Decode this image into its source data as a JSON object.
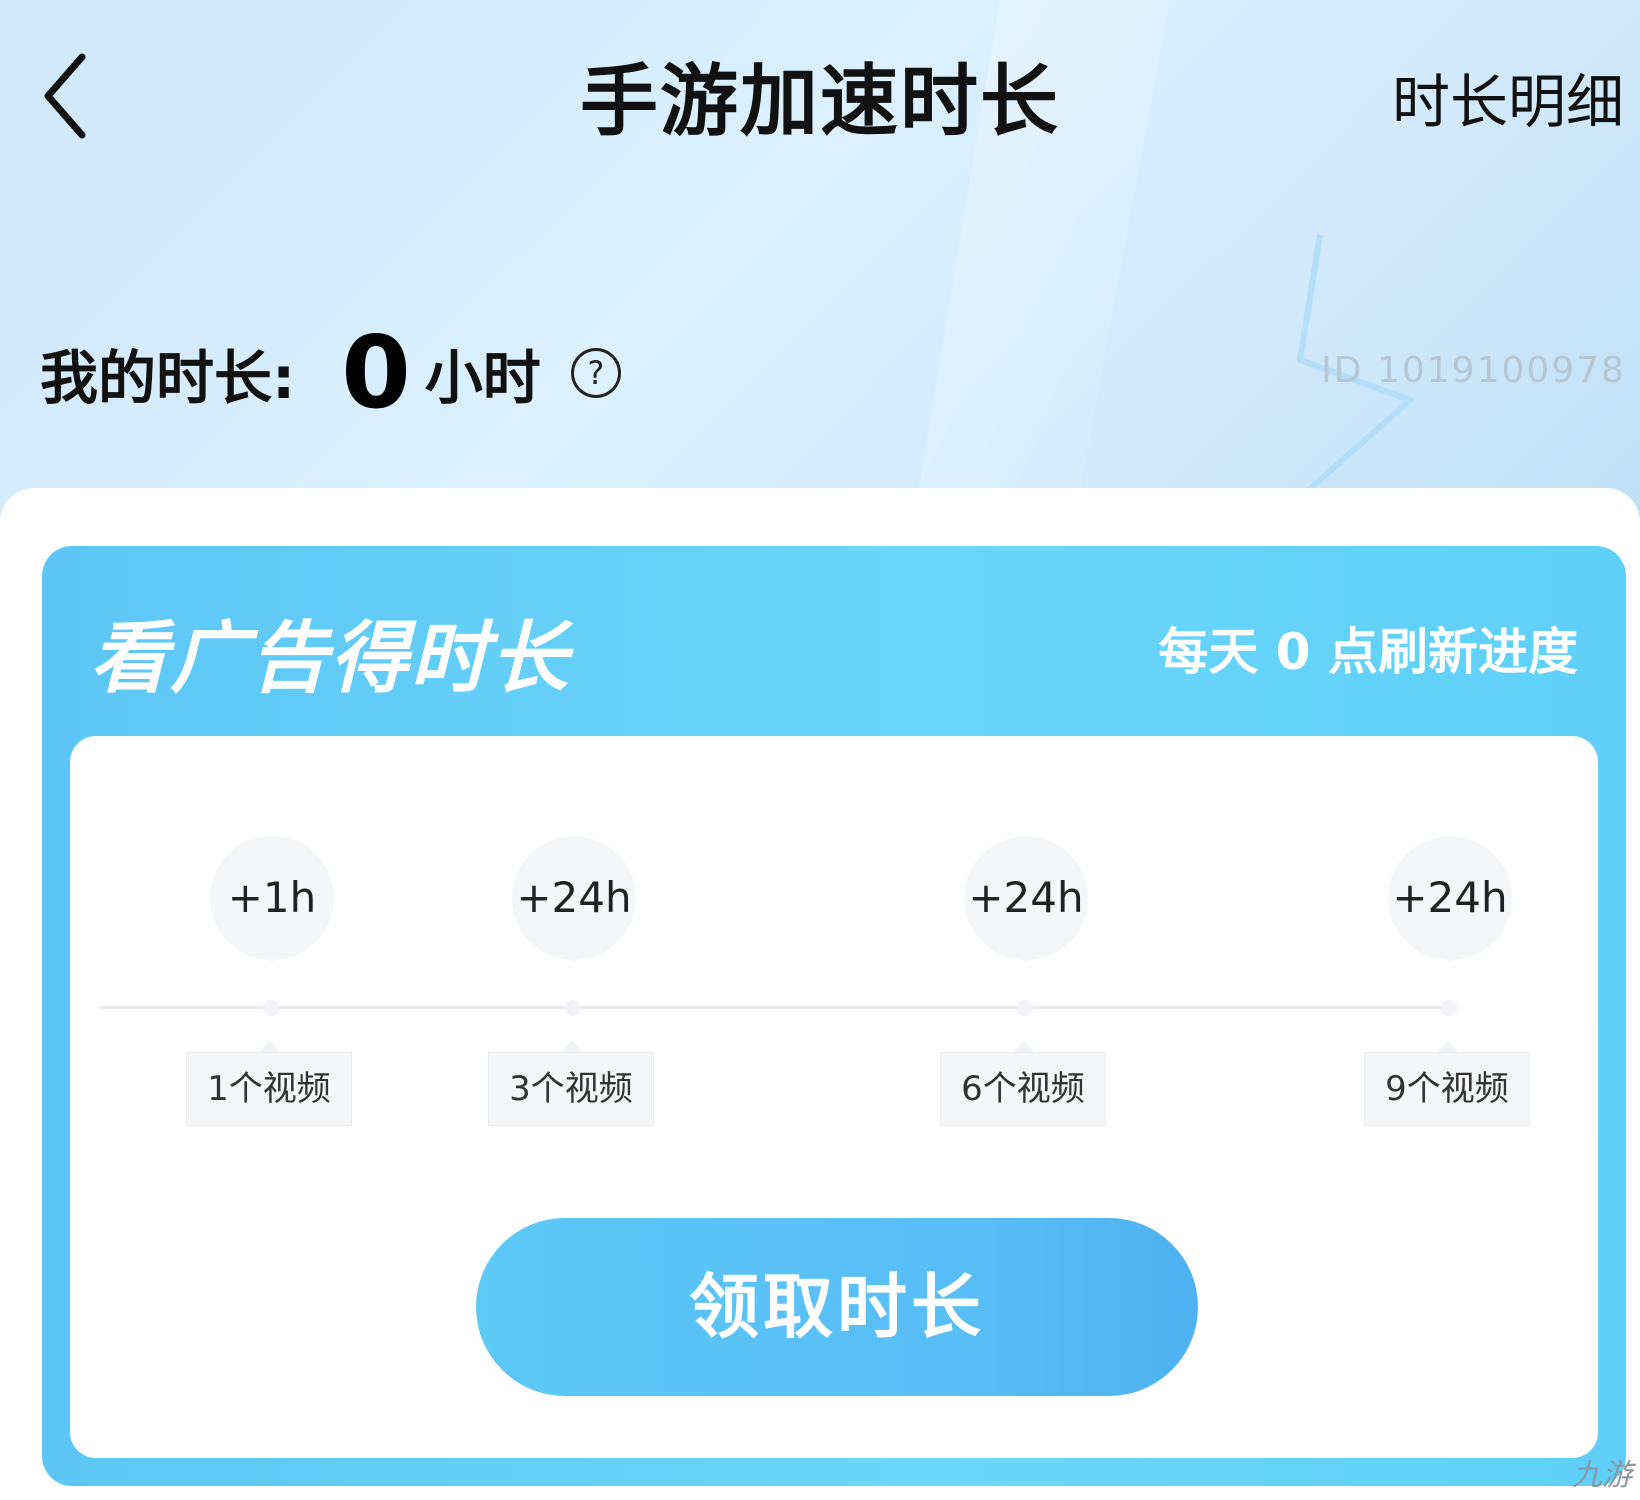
{
  "header": {
    "title": "手游加速时长",
    "detail_link": "时长明细"
  },
  "my_duration": {
    "label": "我的时长:",
    "value": "0",
    "unit": "小时",
    "help_glyph": "?"
  },
  "user": {
    "id_text": "ID 1019100978"
  },
  "ad_card": {
    "title": "看广告得时长",
    "refresh_note": "每天 0 点刷新进度",
    "milestones": [
      {
        "reward": "+1h",
        "requirement": "1个视频"
      },
      {
        "reward": "+24h",
        "requirement": "3个视频"
      },
      {
        "reward": "+24h",
        "requirement": "6个视频"
      },
      {
        "reward": "+24h",
        "requirement": "9个视频"
      }
    ],
    "progress_videos_watched": 0,
    "claim_button": "领取时长"
  },
  "watermark": {
    "text": "九游"
  },
  "colors": {
    "card_accent": "#5cc6f6",
    "button": "#58bdf5",
    "title_text": "#111111",
    "background_top": "#d3ebfb"
  },
  "icons": [
    "back-chevron-icon",
    "help-question-icon"
  ]
}
